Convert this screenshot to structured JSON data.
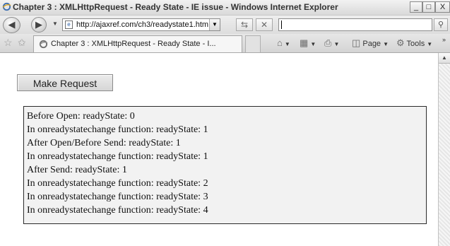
{
  "window": {
    "title": "Chapter 3 : XMLHttpRequest - Ready State - IE issue - Windows Internet Explorer",
    "controls": {
      "minimize": "_",
      "maximize": "□",
      "close": "X"
    }
  },
  "address": {
    "url": "http://ajaxref.com/ch3/readystate1.htm",
    "search_value": "",
    "icons": {
      "back": "back-arrow-icon",
      "forward": "forward-arrow-icon",
      "refresh": "refresh-icon",
      "stop": "stop-icon",
      "search": "magnifier-icon"
    }
  },
  "tabs": {
    "active_tab_label": "Chapter 3 : XMLHttpRequest - Ready State - I...",
    "toolbar": {
      "page_label": "Page",
      "tools_label": "Tools"
    }
  },
  "page": {
    "button_label": "Make Request",
    "output_lines": [
      "Before Open: readyState: 0",
      "In onreadystatechange function: readyState: 1",
      "After Open/Before Send: readyState: 1",
      "In onreadystatechange function: readyState: 1",
      "After Send: readyState: 1",
      "In onreadystatechange function: readyState: 2",
      "In onreadystatechange function: readyState: 3",
      "In onreadystatechange function: readyState: 4"
    ]
  },
  "colors": {
    "output_background": "#f2f2f2",
    "output_border": "#2b2b2b",
    "chrome": "#e2e2e2"
  }
}
